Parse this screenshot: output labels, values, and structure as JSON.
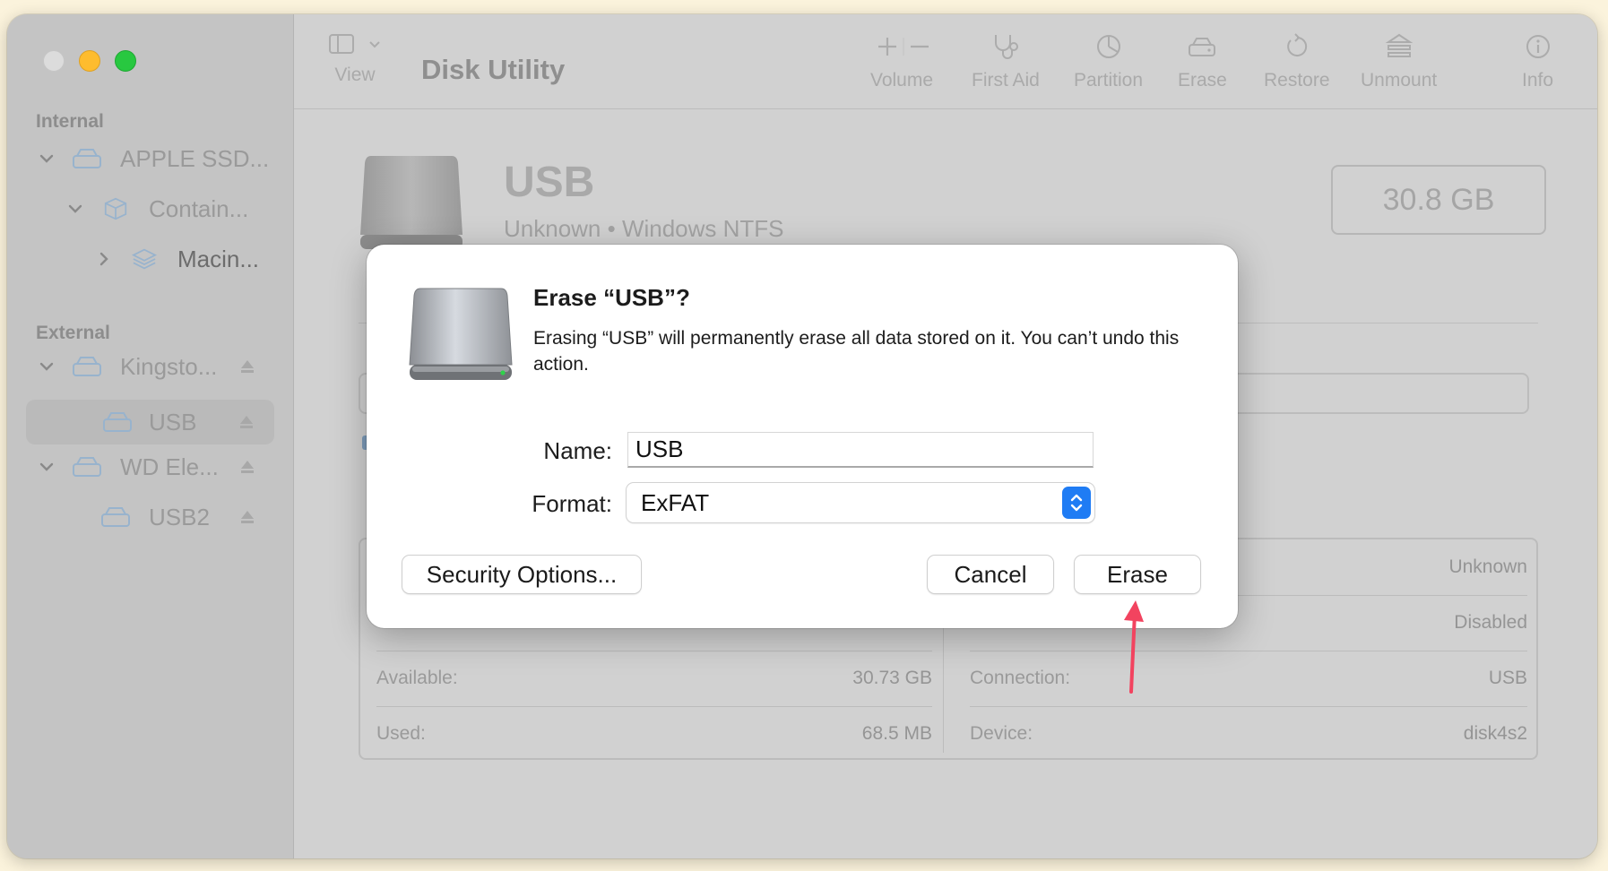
{
  "window": {
    "app_title": "Disk Utility",
    "toolbar": {
      "view_label": "View",
      "items": [
        {
          "label": "Volume",
          "icon": "plus-minus-icon"
        },
        {
          "label": "First Aid",
          "icon": "stethoscope-icon"
        },
        {
          "label": "Partition",
          "icon": "pie-chart-icon"
        },
        {
          "label": "Erase",
          "icon": "erase-disk-icon"
        },
        {
          "label": "Restore",
          "icon": "restore-icon"
        },
        {
          "label": "Unmount",
          "icon": "unmount-icon"
        },
        {
          "label": "Info",
          "icon": "info-icon"
        }
      ]
    }
  },
  "sidebar": {
    "internal_title": "Internal",
    "external_title": "External",
    "internal_items": [
      {
        "label": "APPLE SSD...",
        "icon": "drive-icon"
      },
      {
        "label": "Contain...",
        "icon": "container-icon"
      },
      {
        "label": "Macin...",
        "icon": "volume-stack-icon"
      }
    ],
    "external_items": [
      {
        "label": "Kingsto...",
        "icon": "drive-icon"
      },
      {
        "label": "USB",
        "icon": "drive-icon",
        "selected": true
      },
      {
        "label": "WD Ele...",
        "icon": "drive-icon"
      },
      {
        "label": "USB2",
        "icon": "drive-icon"
      }
    ]
  },
  "disk": {
    "name": "USB",
    "subtitle": "Unknown • Windows NTFS",
    "capacity": "30.8 GB"
  },
  "info": {
    "rows_left": [
      {
        "label": "Available:",
        "value": "30.73 GB"
      },
      {
        "label": "Used:",
        "value": "68.5 MB"
      }
    ],
    "rows_right": [
      {
        "label": "",
        "value": "Unknown"
      },
      {
        "label": "",
        "value": "Disabled"
      },
      {
        "label": "Connection:",
        "value": "USB"
      },
      {
        "label": "Device:",
        "value": "disk4s2"
      }
    ]
  },
  "dialog": {
    "title": "Erase “USB”?",
    "message": "Erasing “USB” will permanently erase all data stored on it. You can’t undo this action.",
    "name_label": "Name:",
    "name_value": "USB",
    "format_label": "Format:",
    "format_value": "ExFAT",
    "security_button": "Security Options...",
    "cancel_button": "Cancel",
    "erase_button": "Erase"
  },
  "colors": {
    "accent": "#1f7cf4",
    "annotation_arrow": "#f2435f",
    "traffic_min": "#febc2e",
    "traffic_max": "#28c840"
  }
}
